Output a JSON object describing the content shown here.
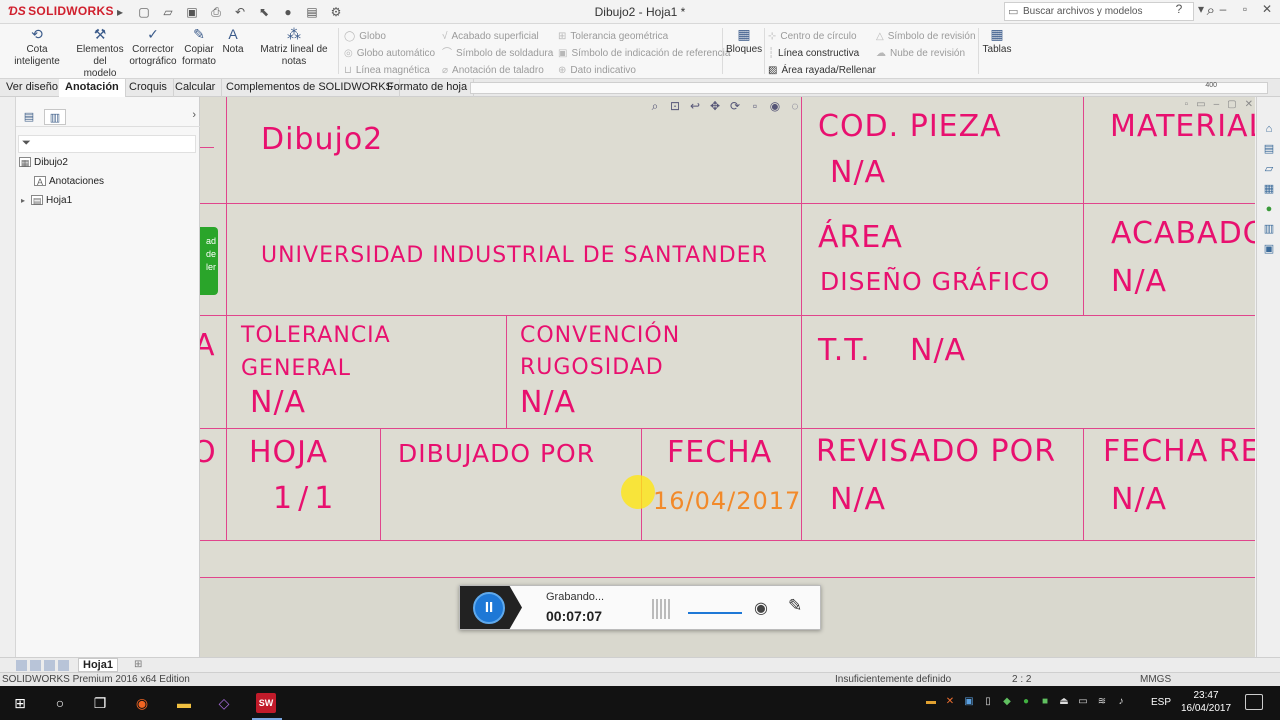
{
  "app": {
    "logo_text": "SOLIDWORKS",
    "doc_title": "Dibujo2 - Hoja1 *",
    "search_placeholder": "Buscar archivos y modelos"
  },
  "ribbon": {
    "cota_inteligente": "Cota inteligente",
    "elementos_modelo_1": "Elementos",
    "elementos_modelo_2": "del modelo",
    "corrector_1": "Corrector",
    "corrector_2": "ortográfico",
    "copiar_1": "Copiar",
    "copiar_2": "formato",
    "nota": "Nota",
    "matriz": "Matriz lineal de notas",
    "col1": [
      "Globo",
      "Globo automático",
      "Línea magnética"
    ],
    "col2": [
      "Acabado superficial",
      "Símbolo de soldadura",
      "Anotación de taladro"
    ],
    "col3": [
      "Tolerancia geométrica",
      "Símbolo de indicación de referencia",
      "Dato indicativo"
    ],
    "bloques": "Bloques",
    "col4": [
      "Centro de círculo",
      "Línea constructiva",
      "Área rayada/Rellenar"
    ],
    "col5": [
      "Símbolo de revisión",
      "Nube de revisión"
    ],
    "tablas": "Tablas"
  },
  "tabs": [
    "Ver diseño",
    "Anotación",
    "Croquis",
    "Calcular",
    "Complementos de SOLIDWORKS",
    "Formato de hoja"
  ],
  "active_tab": "Anotación",
  "tree": {
    "root": "Dibujo2",
    "anotaciones": "Anotaciones",
    "hoja": "Hoja1"
  },
  "titleblock": {
    "dibujo": "Dibujo2",
    "cod_pieza_label": "COD. PIEZA",
    "cod_pieza_value": "N/A",
    "material_label": "MATERIAL",
    "universidad": "UNIVERSIDAD INDUSTRIAL DE SANTANDER",
    "area_label": "ÁREA",
    "area_value": "DISEÑO GRÁFICO",
    "acabado_label": "ACABADO",
    "acabado_value": "N/A",
    "tolerancia_1": "TOLERANCIA",
    "tolerancia_2": "GENERAL",
    "tolerancia_value": "N/A",
    "convencion_1": "CONVENCIÓN",
    "convencion_2": "RUGOSIDAD",
    "convencion_value": "N/A",
    "tt_label": "T.T.",
    "tt_value": "N/A",
    "hoja_label": "HOJA",
    "hoja_value": "1/1",
    "dibujado_por": "DIBUJADO POR",
    "fecha_label": "FECHA",
    "fecha_value": "16/04/2017",
    "revisado_label": "REVISADO POR",
    "revisado_value": "N/A",
    "fecha_rev_label": "FECHA REV",
    "fecha_rev_value": "N/A",
    "left_frag_1": "A",
    "left_frag_2": "O",
    "logo_lines": [
      "ad",
      "de",
      "ler"
    ]
  },
  "recorder": {
    "status": "Grabando...",
    "time": "00:07:07"
  },
  "sheet_tab": "Hoja1",
  "status": {
    "edition": "SOLIDWORKS Premium 2016 x64 Edition",
    "definition": "Insuficientemente definido",
    "scale": "2 : 2",
    "units": "MMGS"
  },
  "taskbar": {
    "sw_label": "SW",
    "lang": "ESP",
    "time": "23:47",
    "date": "16/04/2017"
  },
  "ruler_mark": "400",
  "colors": {
    "line": "#e0458c",
    "text": "#e8106f",
    "date": "#f28a2a",
    "accent": "#1e78d6"
  }
}
